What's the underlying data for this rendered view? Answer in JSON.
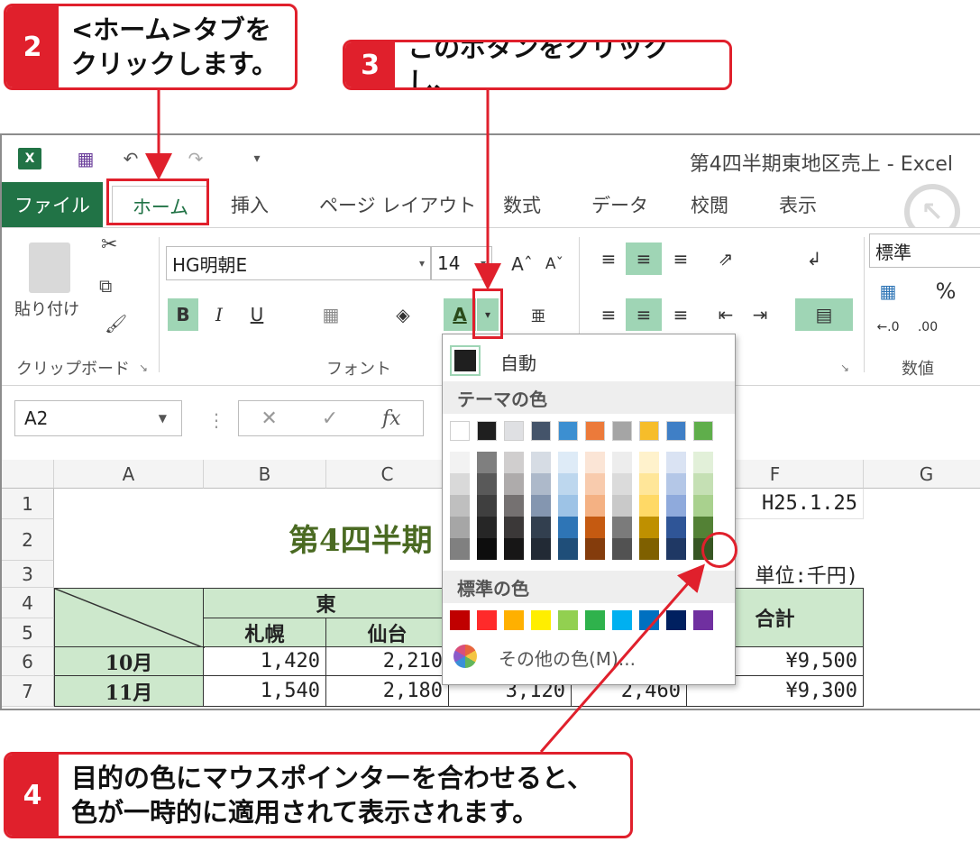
{
  "callouts": {
    "step2": {
      "num": "2",
      "line1": "<ホーム>タブを",
      "line2": "クリックします。"
    },
    "step3": {
      "num": "3",
      "line1": "このボタンをクリックし、"
    },
    "step4": {
      "num": "4",
      "line1": "目的の色にマウスポインターを合わせると、",
      "line2": "色が一時的に適用されて表示されます。"
    }
  },
  "window": {
    "title": "第4四半期東地区売上 - Excel"
  },
  "tabs": [
    "ファイル",
    "ホーム",
    "挿入",
    "ページ レイアウト",
    "数式",
    "データ",
    "校閲",
    "表示"
  ],
  "ribbon": {
    "paste_label": "貼り付け",
    "font_name": "HG明朝E",
    "font_size": "14",
    "bold": "B",
    "italic": "I",
    "underline": "U",
    "number_format": "標準",
    "percent": "%",
    "groups": {
      "clipboard": "クリップボード",
      "font": "フォント",
      "number": "数値"
    }
  },
  "formula_bar": {
    "name_box": "A2",
    "fx": "fx"
  },
  "grid": {
    "columns": [
      "A",
      "B",
      "C",
      "F",
      "G"
    ],
    "rows": [
      "1",
      "2",
      "3",
      "4",
      "5",
      "6",
      "7"
    ],
    "date": "H25.1.25",
    "title": "第4四半期",
    "unit": "単位:千円)",
    "region": "東",
    "total": "合計",
    "cities": [
      "札幌",
      "仙台"
    ],
    "months": [
      "10月",
      "11月"
    ],
    "row6": [
      "1,420",
      "2,210",
      "¥9,500"
    ],
    "row7": [
      "1,540",
      "2,180",
      "3,120",
      "2,460",
      "¥9,300"
    ]
  },
  "color_menu": {
    "auto": "自動",
    "theme_header": "テーマの色",
    "standard_header": "標準の色",
    "more": "その他の色(M)...",
    "theme_top": [
      "#ffffff",
      "#1f1f1f",
      "#dfe0e3",
      "#44546a",
      "#3c8fd1",
      "#ec7a3a",
      "#a5a5a5",
      "#f6bd2a",
      "#3f7fc6",
      "#5fae4b"
    ],
    "theme_shades": [
      [
        "#f2f2f2",
        "#d9d9d9",
        "#bfbfbf",
        "#a6a6a6",
        "#808080"
      ],
      [
        "#7f7f7f",
        "#595959",
        "#3f3f3f",
        "#262626",
        "#0d0d0d"
      ],
      [
        "#d0cece",
        "#aeabab",
        "#757171",
        "#3b3838",
        "#171616"
      ],
      [
        "#d6dce4",
        "#adb9ca",
        "#8496b0",
        "#323f4f",
        "#222a35"
      ],
      [
        "#deebf7",
        "#bdd7ee",
        "#9dc3e6",
        "#2e75b6",
        "#1f4e79"
      ],
      [
        "#fbe5d6",
        "#f8cbad",
        "#f4b183",
        "#c55a11",
        "#843c0c"
      ],
      [
        "#ededed",
        "#dbdbdb",
        "#c9c9c9",
        "#7b7b7b",
        "#525252"
      ],
      [
        "#fff2cc",
        "#ffe699",
        "#ffd966",
        "#bf9000",
        "#7f6000"
      ],
      [
        "#dae3f3",
        "#b4c7e7",
        "#8faadc",
        "#2f5597",
        "#1f3864"
      ],
      [
        "#e2f0d9",
        "#c5e0b4",
        "#a9d18e",
        "#538135",
        "#375623"
      ]
    ],
    "standard": [
      "#c00000",
      "#ff2a2a",
      "#ffb000",
      "#ffee00",
      "#92d050",
      "#2fb24c",
      "#00b0f0",
      "#0070c0",
      "#002060",
      "#7030a0"
    ]
  }
}
